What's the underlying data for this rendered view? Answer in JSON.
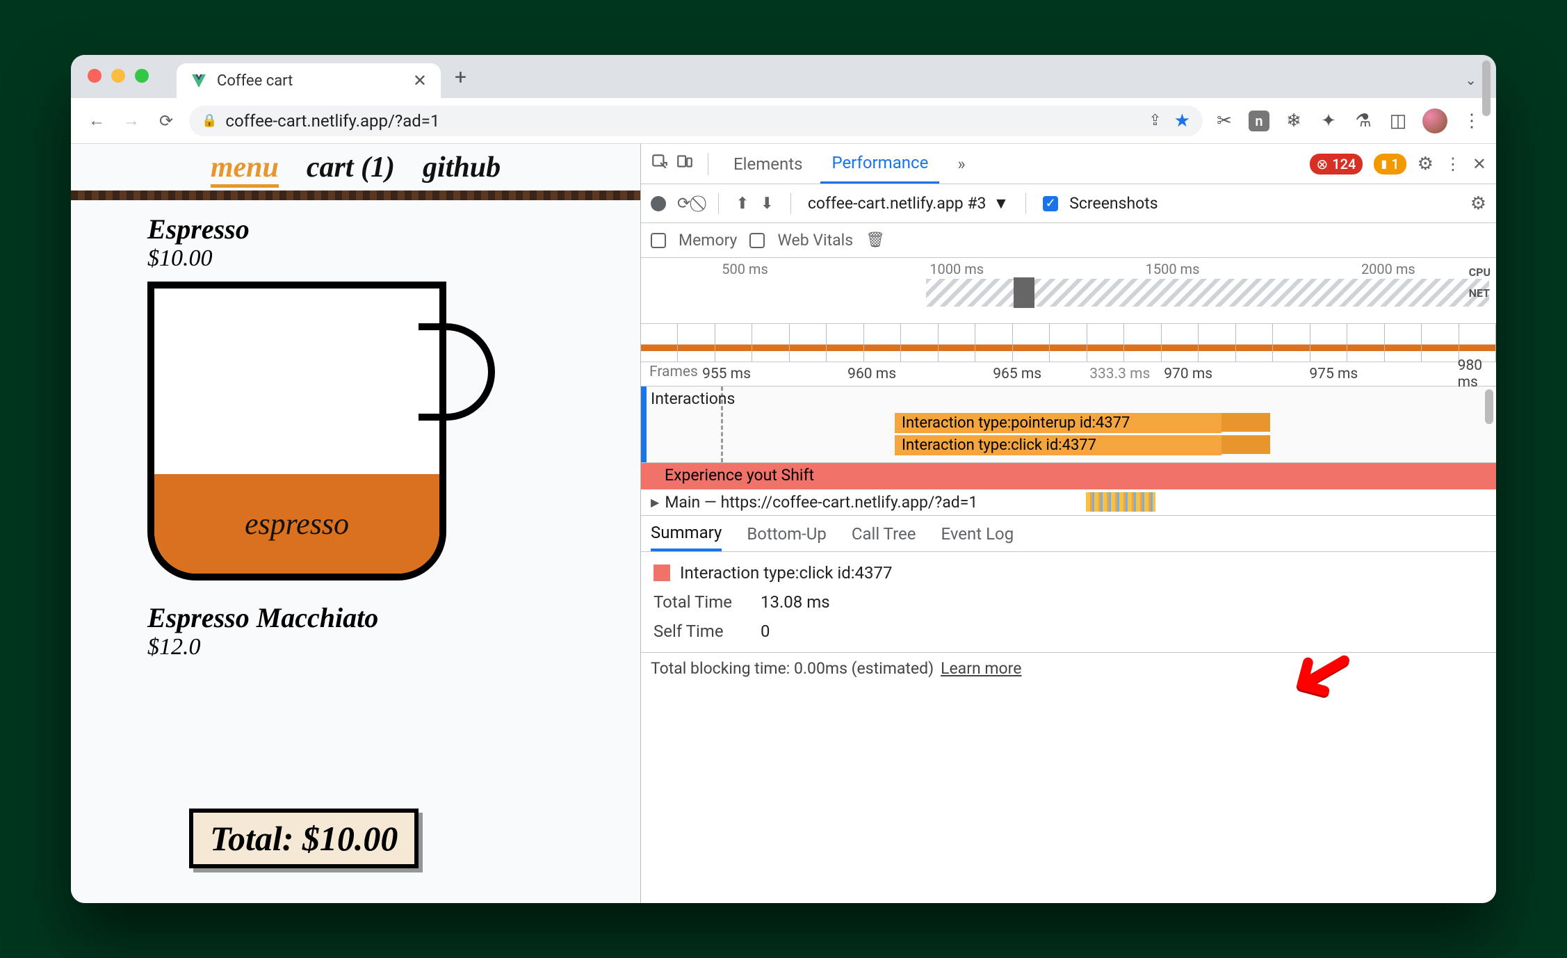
{
  "window": {
    "tab_title": "Coffee cart",
    "url": "coffee-cart.netlify.app/?ad=1"
  },
  "page": {
    "nav": {
      "menu": "menu",
      "cart": "cart (1)",
      "github": "github"
    },
    "item1_name": "Espresso",
    "item1_price": "$10.00",
    "cup_label": "espresso",
    "item2_name": "Espresso Macchiato",
    "item2_price": "$12.0",
    "total": "Total: $10.00"
  },
  "devtools": {
    "tabs": {
      "inspect": "",
      "elements": "Elements",
      "performance": "Performance",
      "more": "»"
    },
    "errors": "124",
    "warnings": "1",
    "row2": {
      "profile": "coffee-cart.netlify.app #3",
      "screenshots": "Screenshots"
    },
    "row3": {
      "memory": "Memory",
      "webvitals": "Web Vitals"
    },
    "overview_ticks": [
      "500 ms",
      "1000 ms",
      "1500 ms",
      "2000 ms"
    ],
    "overview_lanes": {
      "cpu": "CPU",
      "net": "NET"
    },
    "ruler": {
      "frames": "Frames",
      "ticks": [
        "955 ms",
        "960 ms",
        "965 ms",
        "970 ms",
        "975 ms",
        "980 ms"
      ],
      "center": "333.3 ms"
    },
    "interactions": {
      "header": "Interactions",
      "bar1": "Interaction type:pointerup id:4377",
      "bar2": "Interaction type:click id:4377"
    },
    "experience": "Experience    yout Shift",
    "main": "Main — https://coffee-cart.netlify.app/?ad=1",
    "tabs2": {
      "summary": "Summary",
      "bottomup": "Bottom-Up",
      "calltree": "Call Tree",
      "eventlog": "Event Log"
    },
    "summary": {
      "title": "Interaction type:click id:4377",
      "total_k": "Total Time",
      "total_v": "13.08 ms",
      "self_k": "Self Time",
      "self_v": "0"
    },
    "footer": {
      "text": "Total blocking time: 0.00ms (estimated)",
      "link": "Learn more"
    }
  }
}
